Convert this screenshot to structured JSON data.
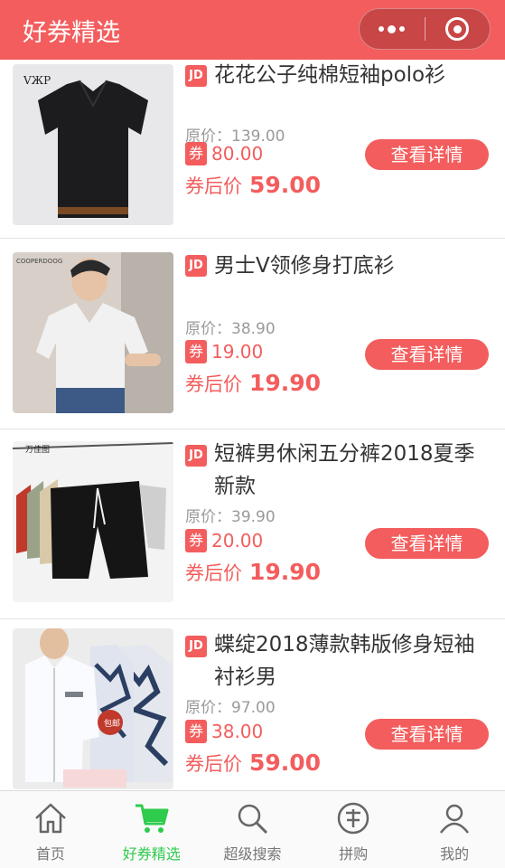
{
  "header": {
    "title": "好券精选"
  },
  "products": [
    {
      "tag": "JD",
      "name": "花花公子纯棉短袖polo衫",
      "original_label": "原价：",
      "original_price": "139.00",
      "coupon_label": "券",
      "coupon_value": "80.00",
      "after_label": "券后价",
      "after_price": "59.00",
      "button": "查看详情"
    },
    {
      "tag": "JD",
      "name": "男士V领修身打底衫",
      "original_label": "原价：",
      "original_price": "38.90",
      "coupon_label": "券",
      "coupon_value": "19.00",
      "after_label": "券后价",
      "after_price": "19.90",
      "button": "查看详情"
    },
    {
      "tag": "JD",
      "name": "短裤男休闲五分裤2018夏季新款",
      "original_label": "原价：",
      "original_price": "39.90",
      "coupon_label": "券",
      "coupon_value": "20.00",
      "after_label": "券后价",
      "after_price": "19.90",
      "button": "查看详情"
    },
    {
      "tag": "JD",
      "name": "蝶绽2018薄款韩版修身短袖衬衫男",
      "original_label": "原价：",
      "original_price": "97.00",
      "coupon_label": "券",
      "coupon_value": "38.00",
      "after_label": "券后价",
      "after_price": "59.00",
      "button": "查看详情"
    }
  ],
  "tabbar": {
    "tabs": [
      {
        "label": "首页",
        "icon": "home-icon"
      },
      {
        "label": "好券精选",
        "icon": "cart-icon"
      },
      {
        "label": "超级搜索",
        "icon": "search-icon"
      },
      {
        "label": "拼购",
        "icon": "group-buy-icon"
      },
      {
        "label": "我的",
        "icon": "user-icon"
      }
    ]
  },
  "colors": {
    "accent": "#f35d5d",
    "active_tab": "#2ecb4d"
  }
}
